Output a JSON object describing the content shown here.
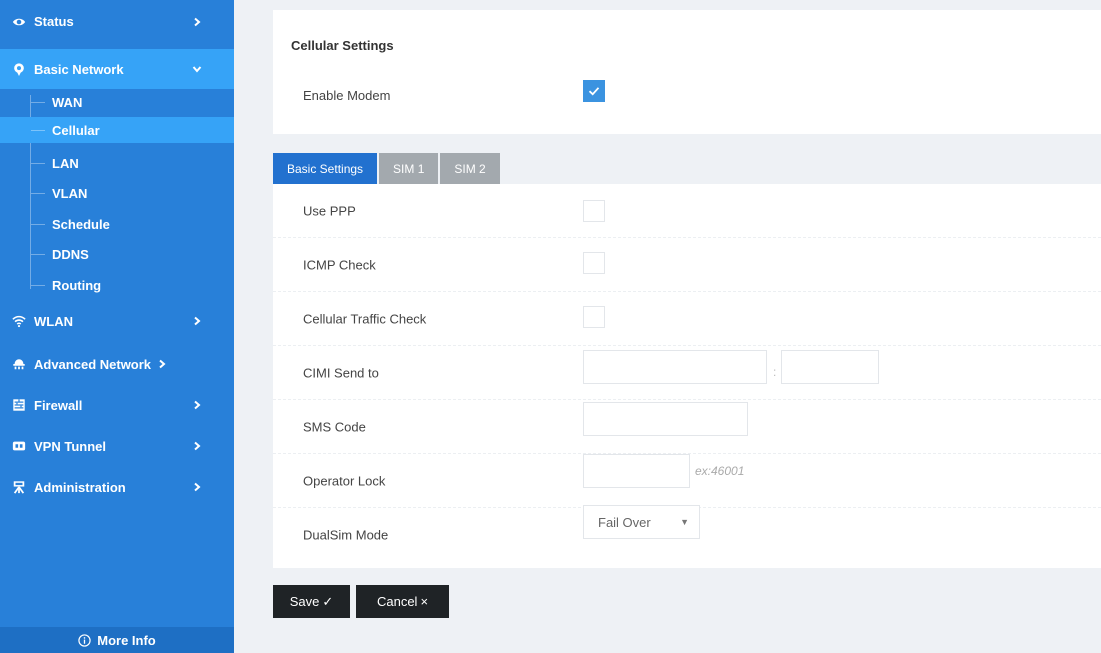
{
  "sidebar": {
    "items": [
      {
        "label": "Status",
        "icon": "eye-icon"
      },
      {
        "label": "Basic Network",
        "icon": "network-icon"
      },
      {
        "label": "WLAN",
        "icon": "wifi-icon"
      },
      {
        "label": "Advanced Network",
        "icon": "cloud-network-icon"
      },
      {
        "label": "Firewall",
        "icon": "firewall-icon"
      },
      {
        "label": "VPN Tunnel",
        "icon": "vpn-icon"
      },
      {
        "label": "Administration",
        "icon": "admin-icon"
      }
    ],
    "sub_items": [
      "WAN",
      "Cellular",
      "LAN",
      "VLAN",
      "Schedule",
      "DDNS",
      "Routing"
    ],
    "more_info": "More Info",
    "colors": {
      "background": "#2880d9",
      "active": "#36a3f7"
    }
  },
  "cellular": {
    "title": "Cellular Settings",
    "enable_modem": {
      "label": "Enable Modem",
      "checked": true
    }
  },
  "tabs": [
    {
      "label": "Basic Settings",
      "active": true
    },
    {
      "label": "SIM 1",
      "active": false
    },
    {
      "label": "SIM 2",
      "active": false
    }
  ],
  "basic": {
    "use_ppp": {
      "label": "Use PPP",
      "checked": false
    },
    "icmp_check": {
      "label": "ICMP Check",
      "checked": false
    },
    "traffic_check": {
      "label": "Cellular Traffic Check",
      "checked": false
    },
    "cimi_send_to": {
      "label": "CIMI Send to",
      "host": "",
      "separator": ":",
      "port": ""
    },
    "sms_code": {
      "label": "SMS Code",
      "value": ""
    },
    "operator_lock": {
      "label": "Operator Lock",
      "value": "",
      "hint": "ex:46001"
    },
    "dualsim_mode": {
      "label": "DualSim Mode",
      "value": "Fail Over",
      "caret": "▼"
    }
  },
  "buttons": {
    "save": "Save",
    "save_icon": "✓",
    "cancel": "Cancel",
    "cancel_icon": "×"
  },
  "colors": {
    "accent": "#2271cf",
    "checkbox": "#3b93e0",
    "button": "#1f2326"
  }
}
